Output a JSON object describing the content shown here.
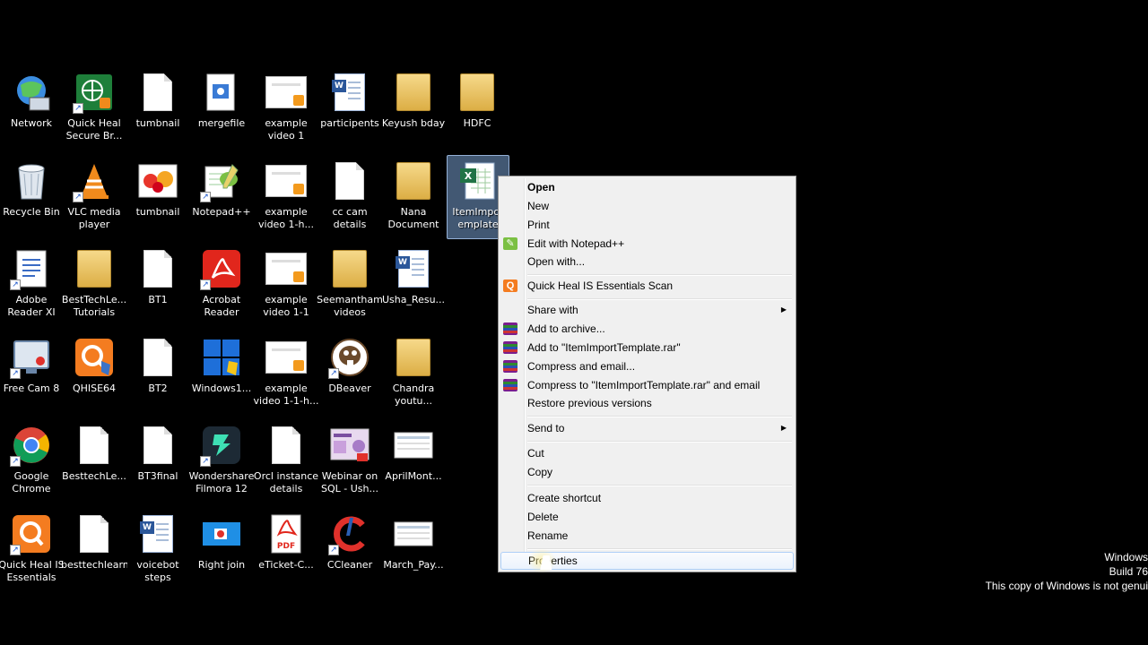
{
  "desktop_icons": [
    {
      "label": "Network",
      "icon": "network-icon"
    },
    {
      "label": "Quick Heal Secure Br...",
      "icon": "quick-heal-browser-icon"
    },
    {
      "label": "tumbnail",
      "icon": "document-icon"
    },
    {
      "label": "mergefile",
      "icon": "media-file-icon"
    },
    {
      "label": "example video 1",
      "icon": "video-file-icon"
    },
    {
      "label": "participents",
      "icon": "word-document-icon"
    },
    {
      "label": "Keyush bday",
      "icon": "folder-icon"
    },
    {
      "label": "HDFC",
      "icon": "folder-icon"
    },
    {
      "label": "Recycle Bin",
      "icon": "recycle-bin-icon"
    },
    {
      "label": "VLC media player",
      "icon": "vlc-icon"
    },
    {
      "label": "tumbnail",
      "icon": "image-icon"
    },
    {
      "label": "Notepad++",
      "icon": "notepad-plus-plus-icon"
    },
    {
      "label": "example video 1-h...",
      "icon": "video-file-icon"
    },
    {
      "label": "cc cam details",
      "icon": "document-icon"
    },
    {
      "label": "Nana Document",
      "icon": "folder-icon"
    },
    {
      "label": "ItemImportTemplate",
      "icon": "excel-file-icon",
      "visible_label": "ItemImpor emplate"
    },
    {
      "label": "Adobe Reader XI",
      "icon": "adobe-reader-icon"
    },
    {
      "label": "BestTechLe... Tutorials",
      "icon": "folder-icon"
    },
    {
      "label": "BT1",
      "icon": "document-icon"
    },
    {
      "label": "Acrobat Reader",
      "icon": "acrobat-icon"
    },
    {
      "label": "example video 1-1",
      "icon": "video-file-icon"
    },
    {
      "label": "Seemantham videos",
      "icon": "folder-icon"
    },
    {
      "label": "Usha_Resu...",
      "icon": "word-document-icon"
    },
    {
      "label": "Free Cam 8",
      "icon": "free-cam-icon"
    },
    {
      "label": "QHISE64",
      "icon": "qhise-icon"
    },
    {
      "label": "BT2",
      "icon": "document-icon"
    },
    {
      "label": "Windows1...",
      "icon": "windows-icon"
    },
    {
      "label": "example video 1-1-h...",
      "icon": "video-file-icon"
    },
    {
      "label": "DBeaver",
      "icon": "dbeaver-icon"
    },
    {
      "label": "Chandra youtu...",
      "icon": "folder-icon"
    },
    {
      "label": "Google Chrome",
      "icon": "chrome-icon"
    },
    {
      "label": "BesttechLe...",
      "icon": "document-icon"
    },
    {
      "label": "BT3final",
      "icon": "document-icon"
    },
    {
      "label": "Wondershare Filmora 12",
      "icon": "filmora-icon"
    },
    {
      "label": "Orcl instance details",
      "icon": "document-icon"
    },
    {
      "label": "Webinar on SQL - Ush...",
      "icon": "image-icon"
    },
    {
      "label": "AprilMont...",
      "icon": "image-icon"
    },
    {
      "label": "Quick Heal IS Essentials",
      "icon": "quick-heal-icon"
    },
    {
      "label": "besttechlearn",
      "icon": "document-icon"
    },
    {
      "label": "voicebot steps",
      "icon": "word-document-icon"
    },
    {
      "label": "Right join",
      "icon": "image-icon"
    },
    {
      "label": "eTicket-C...",
      "icon": "pdf-icon"
    },
    {
      "label": "CCleaner",
      "icon": "ccleaner-icon"
    },
    {
      "label": "March_Pay...",
      "icon": "image-icon"
    }
  ],
  "context_menu": {
    "items": [
      {
        "label": "Open",
        "bold": true
      },
      {
        "label": "New"
      },
      {
        "label": "Print"
      },
      {
        "label": "Edit with Notepad++",
        "icon": "notepad-plus-plus-icon"
      },
      {
        "label": "Open with..."
      },
      {
        "label": "Quick Heal IS Essentials Scan",
        "icon": "quick-heal-icon"
      },
      {
        "label": "Share with",
        "submenu": true
      },
      {
        "label": "Add to archive...",
        "icon": "winrar-icon"
      },
      {
        "label": "Add to \"ItemImportTemplate.rar\"",
        "icon": "winrar-icon"
      },
      {
        "label": "Compress and email...",
        "icon": "winrar-icon"
      },
      {
        "label": "Compress to \"ItemImportTemplate.rar\" and email",
        "icon": "winrar-icon"
      },
      {
        "label": "Restore previous versions"
      },
      {
        "label": "Send to",
        "submenu": true
      },
      {
        "label": "Cut"
      },
      {
        "label": "Copy"
      },
      {
        "label": "Create shortcut"
      },
      {
        "label": "Delete"
      },
      {
        "label": "Rename"
      },
      {
        "label": "Properties",
        "hover": true
      }
    ]
  },
  "watermark": {
    "line1": "Windows",
    "line2": "Build 76",
    "line3": "This copy of Windows is not genui"
  },
  "colors": {
    "desktop_background": "#000000",
    "menu_background": "#f0f0f0",
    "selection_highlight": "#aecff7"
  }
}
